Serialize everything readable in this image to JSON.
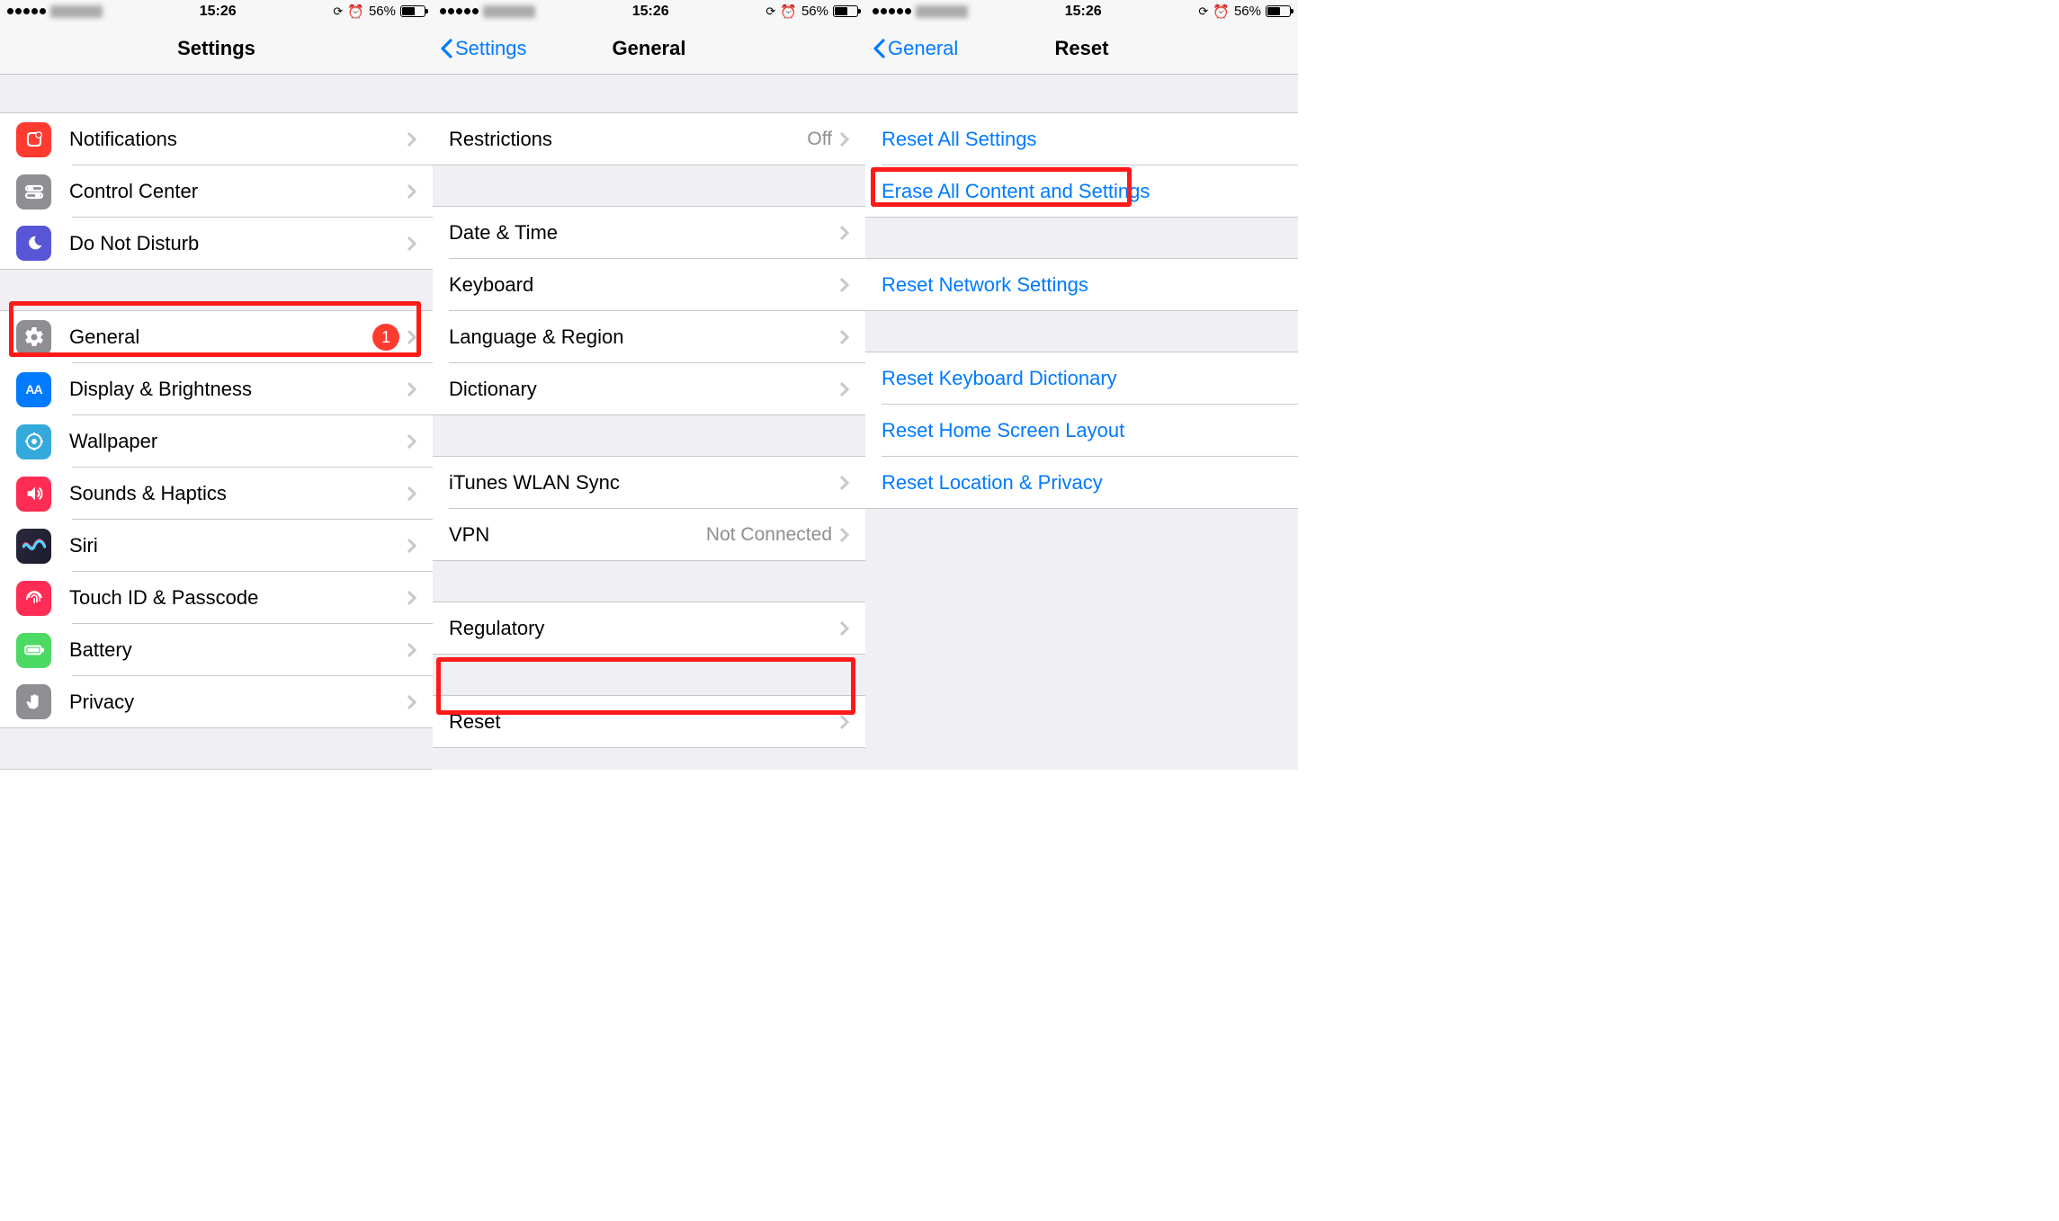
{
  "status": {
    "time": "15:26",
    "battery_pct": "56%"
  },
  "screen1": {
    "title": "Settings",
    "general_badge": "1",
    "rows": {
      "notifications": "Notifications",
      "control_center": "Control Center",
      "dnd": "Do Not Disturb",
      "general": "General",
      "display": "Display & Brightness",
      "wallpaper": "Wallpaper",
      "sounds": "Sounds & Haptics",
      "siri": "Siri",
      "touchid": "Touch ID & Passcode",
      "battery": "Battery",
      "privacy": "Privacy"
    }
  },
  "screen2": {
    "back": "Settings",
    "title": "General",
    "rows": {
      "restrictions": "Restrictions",
      "restrictions_val": "Off",
      "date_time": "Date & Time",
      "keyboard": "Keyboard",
      "lang_region": "Language & Region",
      "dictionary": "Dictionary",
      "itunes_sync": "iTunes WLAN Sync",
      "vpn": "VPN",
      "vpn_val": "Not Connected",
      "regulatory": "Regulatory",
      "reset": "Reset"
    }
  },
  "screen3": {
    "back": "General",
    "title": "Reset",
    "rows": {
      "reset_all": "Reset All Settings",
      "erase_all": "Erase All Content and Settings",
      "reset_network": "Reset Network Settings",
      "reset_keyboard": "Reset Keyboard Dictionary",
      "reset_home": "Reset Home Screen Layout",
      "reset_location": "Reset Location & Privacy"
    }
  }
}
